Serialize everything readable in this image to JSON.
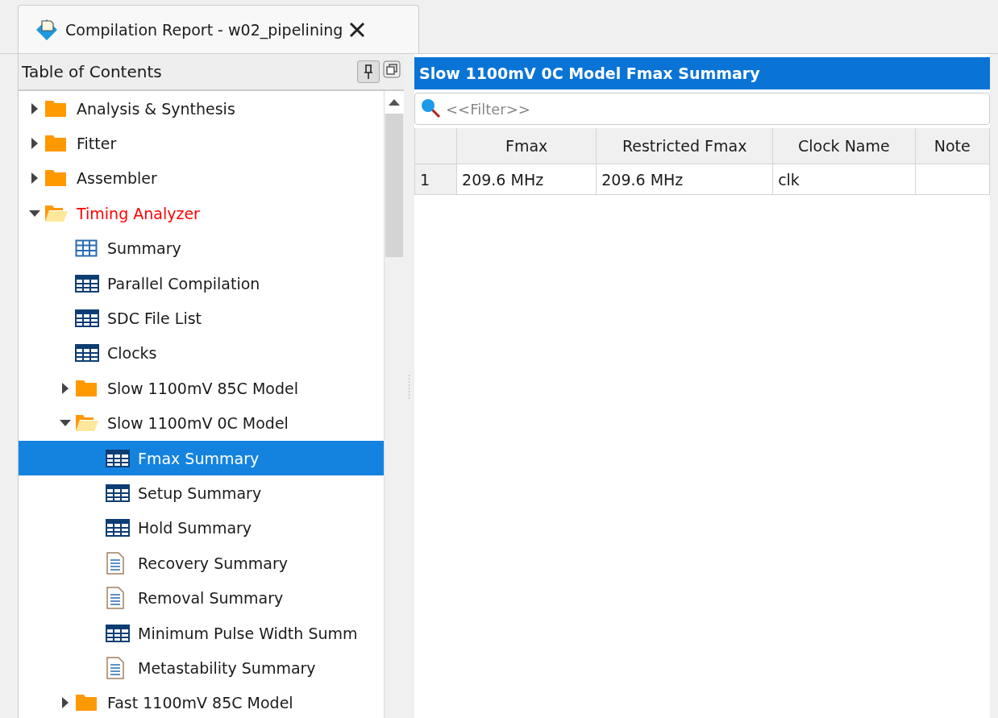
{
  "tab": {
    "title": "Compilation Report - w02_pipelining"
  },
  "toc": {
    "title": "Table of Contents",
    "items": [
      {
        "label": "Analysis & Synthesis",
        "kind": "folder",
        "expanded": false,
        "selected": false
      },
      {
        "label": "Fitter",
        "kind": "folder",
        "expanded": false,
        "selected": false
      },
      {
        "label": "Assembler",
        "kind": "folder",
        "expanded": false,
        "selected": false
      },
      {
        "label": "Timing Analyzer",
        "kind": "folder",
        "expanded": true,
        "selected": false,
        "color": "#ff0000",
        "children": [
          {
            "label": "Summary",
            "kind": "summary",
            "selected": false
          },
          {
            "label": "Parallel Compilation",
            "kind": "table",
            "selected": false
          },
          {
            "label": "SDC File List",
            "kind": "table",
            "selected": false
          },
          {
            "label": "Clocks",
            "kind": "table",
            "selected": false
          },
          {
            "label": "Slow 1100mV 85C Model",
            "kind": "folder",
            "expanded": false,
            "selected": false
          },
          {
            "label": "Slow 1100mV 0C Model",
            "kind": "folder",
            "expanded": true,
            "selected": false,
            "children": [
              {
                "label": "Fmax Summary",
                "kind": "table",
                "selected": true
              },
              {
                "label": "Setup Summary",
                "kind": "table",
                "selected": false
              },
              {
                "label": "Hold Summary",
                "kind": "table",
                "selected": false
              },
              {
                "label": "Recovery Summary",
                "kind": "doc",
                "selected": false
              },
              {
                "label": "Removal Summary",
                "kind": "doc",
                "selected": false
              },
              {
                "label": "Minimum Pulse Width Summ",
                "kind": "table",
                "selected": false
              },
              {
                "label": "Metastability Summary",
                "kind": "doc",
                "selected": false
              }
            ]
          },
          {
            "label": "Fast 1100mV 85C Model",
            "kind": "folder",
            "expanded": false,
            "selected": false
          }
        ]
      }
    ]
  },
  "report": {
    "title": "Slow 1100mV 0C Model Fmax Summary",
    "filter": {
      "placeholder": "<<Filter>>"
    },
    "table": {
      "columns": [
        "Fmax",
        "Restricted Fmax",
        "Clock Name",
        "Note"
      ],
      "rows": [
        {
          "index": "1",
          "cells": [
            "209.6 MHz",
            "209.6 MHz",
            "clk",
            ""
          ]
        }
      ]
    }
  }
}
